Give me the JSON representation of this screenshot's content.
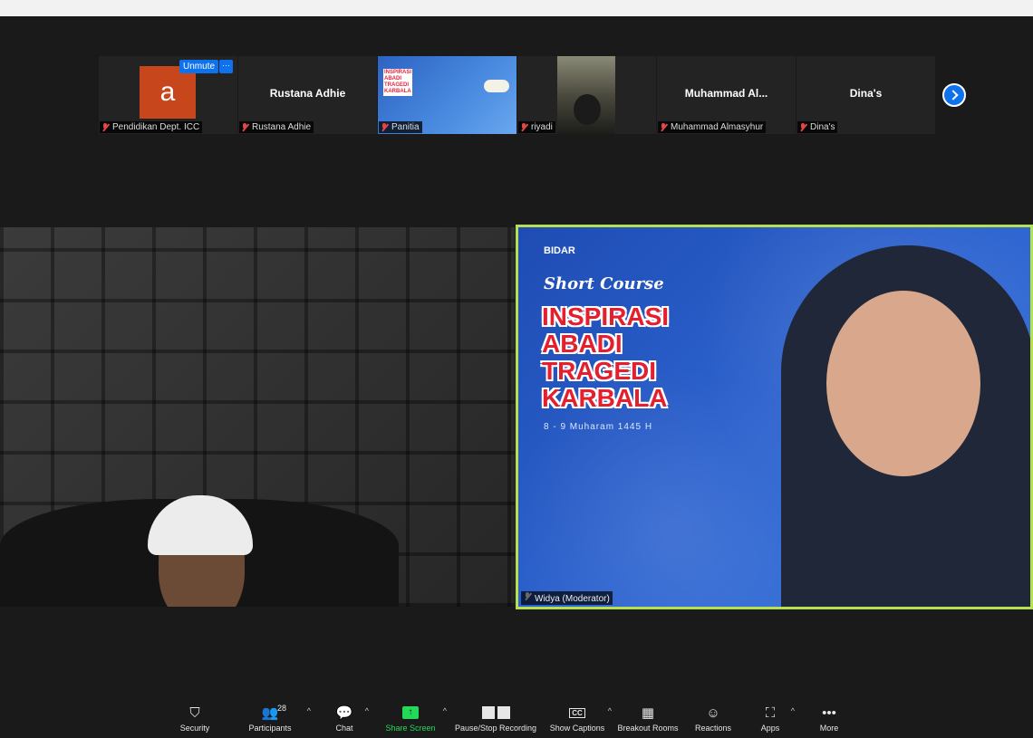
{
  "thumbnails": [
    {
      "display_name": "",
      "label": "Pendidikan Dept. ICC",
      "avatar_letter": "a",
      "unmute": "Unmute",
      "more": "···"
    },
    {
      "display_name": "Rustana Adhie",
      "label": "Rustana Adhie"
    },
    {
      "display_name": "",
      "label": "Panitia"
    },
    {
      "display_name": "",
      "label": "riyadi"
    },
    {
      "display_name": "Muhammad  Al...",
      "label": "Muhammad Almasyhur"
    },
    {
      "display_name": "Dina's",
      "label": "Dina's"
    }
  ],
  "slide": {
    "logo": "BIDAR",
    "subtitle": "Short Course",
    "title_lines": [
      "INSPIRASI",
      "ABADI",
      "TRAGEDI",
      "KARBALA"
    ],
    "date": "8 - 9 Muharam 1445 H"
  },
  "video_main_label": "Widya (Moderator)",
  "toolbar": {
    "security": "Security",
    "participants": "Participants",
    "participants_count": "28",
    "chat": "Chat",
    "share": "Share Screen",
    "record": "Pause/Stop Recording",
    "captions": "Show Captions",
    "breakout": "Breakout Rooms",
    "reactions": "Reactions",
    "apps": "Apps",
    "more": "More"
  },
  "colors": {
    "accent": "#0e72ed",
    "active_speaker_border": "#b7df52",
    "share_green": "#23d959",
    "muted_red": "#e04848"
  }
}
